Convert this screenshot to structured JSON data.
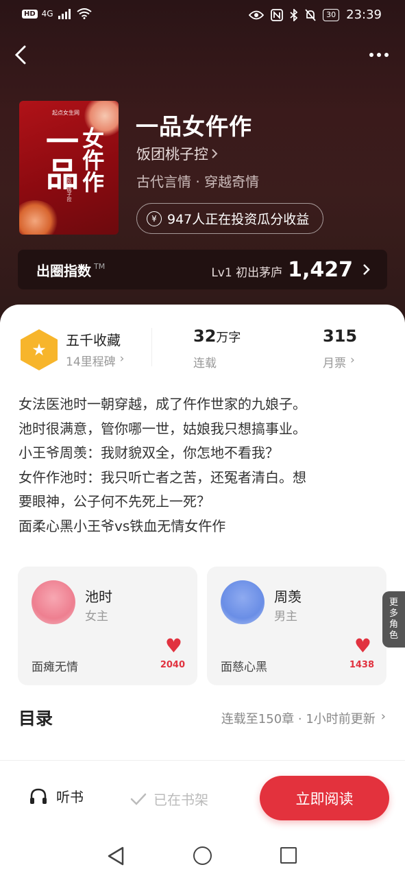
{
  "status_bar": {
    "network_badge": "HD",
    "signal": "4G",
    "battery": "30",
    "time": "23:39"
  },
  "book": {
    "title": "一品女仵作",
    "author": "饭团桃子控",
    "genres": "古代言情 · 穿越奇情",
    "invest_text": "947人正在投资瓜分收益",
    "cover": {
      "publisher": "起点女生网",
      "title_main": "一品",
      "title_sub": "女仵作",
      "author_vertical": "饭团桃子控"
    }
  },
  "influence": {
    "label": "出圈指数",
    "tm": "TM",
    "level": "Lv1 初出茅庐",
    "value": "1,427"
  },
  "stats": {
    "collection_main": "五千收藏",
    "collection_sub": "14里程碑",
    "words_num": "32",
    "words_unit": "万字",
    "words_sub": "连载",
    "votes_num": "315",
    "votes_sub": "月票"
  },
  "synopsis": [
    "女法医池时一朝穿越，成了仵作世家的九娘子。",
    "池时很满意，管你哪一世，姑娘我只想搞事业。",
    "小王爷周羡：我财貌双全，你怎地不看我？",
    "女仵作池时：我只听亡者之苦，还冤者清白。想",
    "要眼神，公子何不先死上一死？",
    "面柔心黑小王爷vs铁血无情女仵作"
  ],
  "characters": [
    {
      "name": "池时",
      "role": "女主",
      "tag": "面瘫无情",
      "likes": "2040"
    },
    {
      "name": "周羡",
      "role": "男主",
      "tag": "面慈心黑",
      "likes": "1438"
    }
  ],
  "more_characters": "更多角色",
  "toc": {
    "title": "目录",
    "info": "连载至150章 · 1小时前更新"
  },
  "bottom": {
    "listen": "听书",
    "shelf": "已在书架",
    "read": "立即阅读"
  },
  "colors": {
    "accent": "#e3323d",
    "hero_bg": "#3a1a1b",
    "badge": "#f7b52b"
  }
}
